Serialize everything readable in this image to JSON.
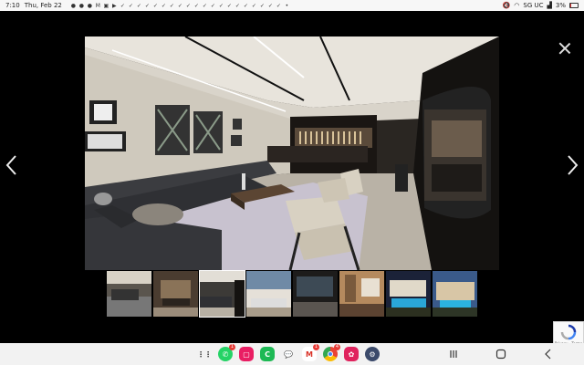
{
  "status_bar": {
    "time": "7:10",
    "date": "Thu, Feb 22",
    "carrier": "SG UC",
    "battery": "3%",
    "battery_level": 0.03,
    "battery_color": "#d33333"
  },
  "lightbox": {
    "background": "#000000",
    "thumbnail_count": 8,
    "active_thumbnail": 2
  },
  "recaptcha": {
    "line1": "Privacy - Terms"
  },
  "dock_apps": [
    {
      "name": "apps-grid-icon",
      "badge": ""
    },
    {
      "name": "whatsapp-icon",
      "badge": "1"
    },
    {
      "name": "app-pink-icon",
      "badge": ""
    },
    {
      "name": "app-green-icon",
      "badge": ""
    },
    {
      "name": "messages-icon",
      "badge": ""
    },
    {
      "name": "gmail-icon",
      "badge": "1"
    },
    {
      "name": "chrome-icon",
      "badge": "4"
    },
    {
      "name": "app-flower-icon",
      "badge": ""
    },
    {
      "name": "settings-icon",
      "badge": ""
    }
  ]
}
